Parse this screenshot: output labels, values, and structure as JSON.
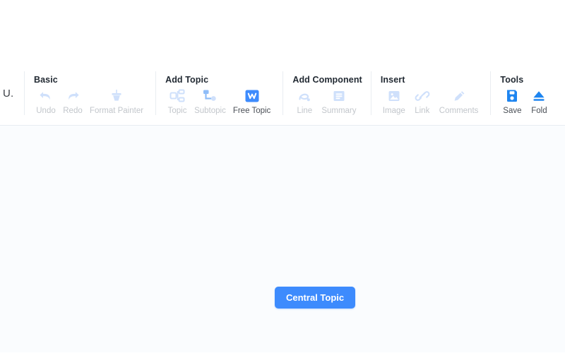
{
  "brand": {
    "label": "U."
  },
  "toolbar": {
    "groups": [
      {
        "title": "Basic",
        "items": [
          {
            "label": "Undo",
            "icon": "undo-icon",
            "active": false
          },
          {
            "label": "Redo",
            "icon": "redo-icon",
            "active": false
          },
          {
            "label": "Format Painter",
            "icon": "format-painter-icon",
            "active": false
          }
        ]
      },
      {
        "title": "Add Topic",
        "items": [
          {
            "label": "Topic",
            "icon": "topic-icon",
            "active": false
          },
          {
            "label": "Subtopic",
            "icon": "subtopic-icon",
            "active": false
          },
          {
            "label": "Free Topic",
            "icon": "free-topic-icon",
            "active": true
          }
        ]
      },
      {
        "title": "Add Component",
        "items": [
          {
            "label": "Line",
            "icon": "line-icon",
            "active": false
          },
          {
            "label": "Summary",
            "icon": "summary-icon",
            "active": false
          }
        ]
      },
      {
        "title": "Insert",
        "items": [
          {
            "label": "Image",
            "icon": "image-icon",
            "active": false
          },
          {
            "label": "Link",
            "icon": "link-icon",
            "active": false
          },
          {
            "label": "Comments",
            "icon": "comments-icon",
            "active": false
          }
        ]
      },
      {
        "title": "Tools",
        "items": [
          {
            "label": "Save",
            "icon": "save-icon",
            "active": true
          },
          {
            "label": "Fold",
            "icon": "fold-icon",
            "active": true
          }
        ]
      }
    ]
  },
  "canvas": {
    "central_topic": {
      "label": "Central Topic"
    }
  },
  "colors": {
    "accent": "#3d8bfd",
    "icon_disabled": "#cfe0fb",
    "label_disabled": "#c2c6cb",
    "label_active": "#4a4f56",
    "canvas_bg": "#fafcfe",
    "toolbar_bg": "#ffffff",
    "divider": "#e9edf1"
  }
}
